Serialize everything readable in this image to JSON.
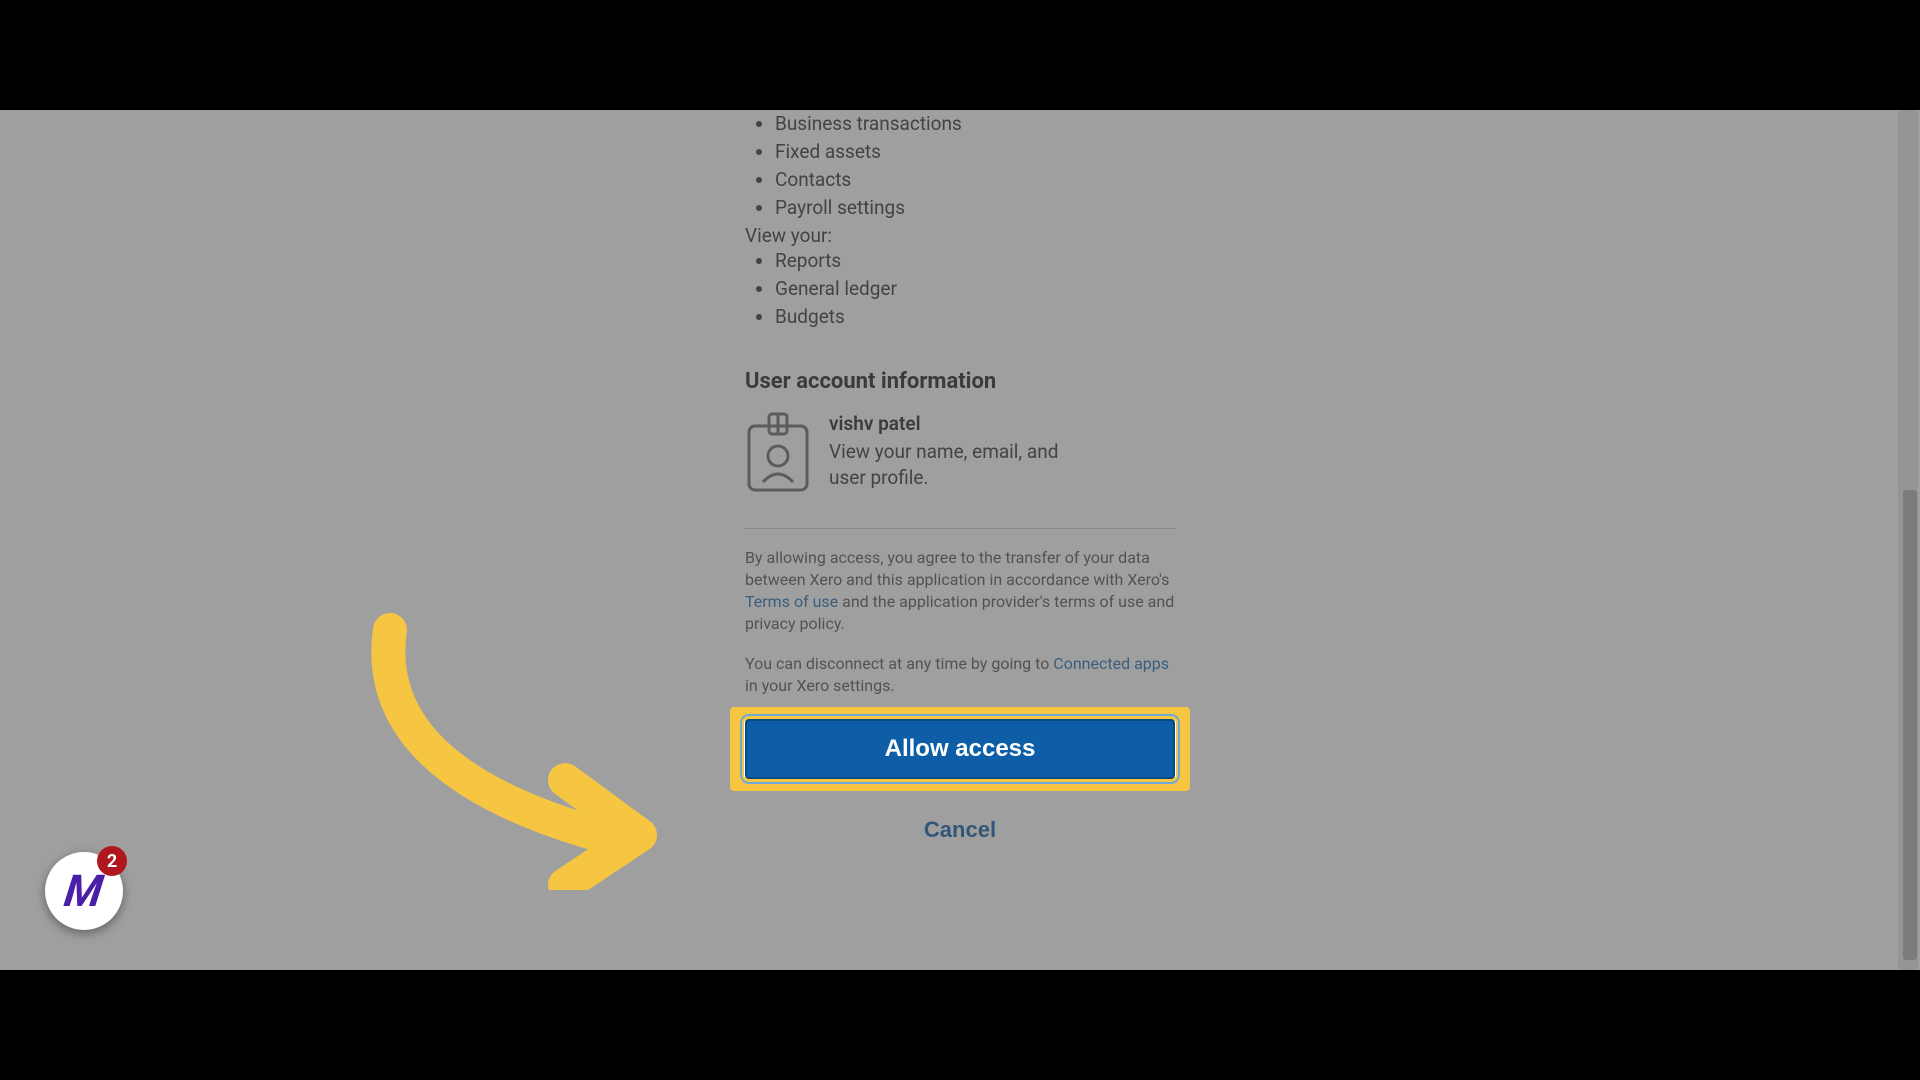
{
  "permissions": {
    "edit_items": [
      "Business transactions",
      "Fixed assets",
      "Contacts",
      "Payroll settings"
    ],
    "view_label": "View your:",
    "view_items": [
      "Reports",
      "General ledger",
      "Budgets"
    ]
  },
  "user_info": {
    "heading": "User account information",
    "name": "vishv patel",
    "description": "View your name, email, and user profile."
  },
  "legal": {
    "prefix": "By allowing access, you agree to the transfer of your data between Xero and this application in accordance with Xero's ",
    "terms_link": "Terms of use",
    "suffix": " and the application provider's terms of use and privacy policy."
  },
  "disconnect": {
    "prefix": "You can disconnect at any time by going to ",
    "link": "Connected apps",
    "suffix": " in your Xero settings."
  },
  "buttons": {
    "allow": "Allow access",
    "cancel": "Cancel"
  },
  "fab": {
    "badge": "2"
  }
}
